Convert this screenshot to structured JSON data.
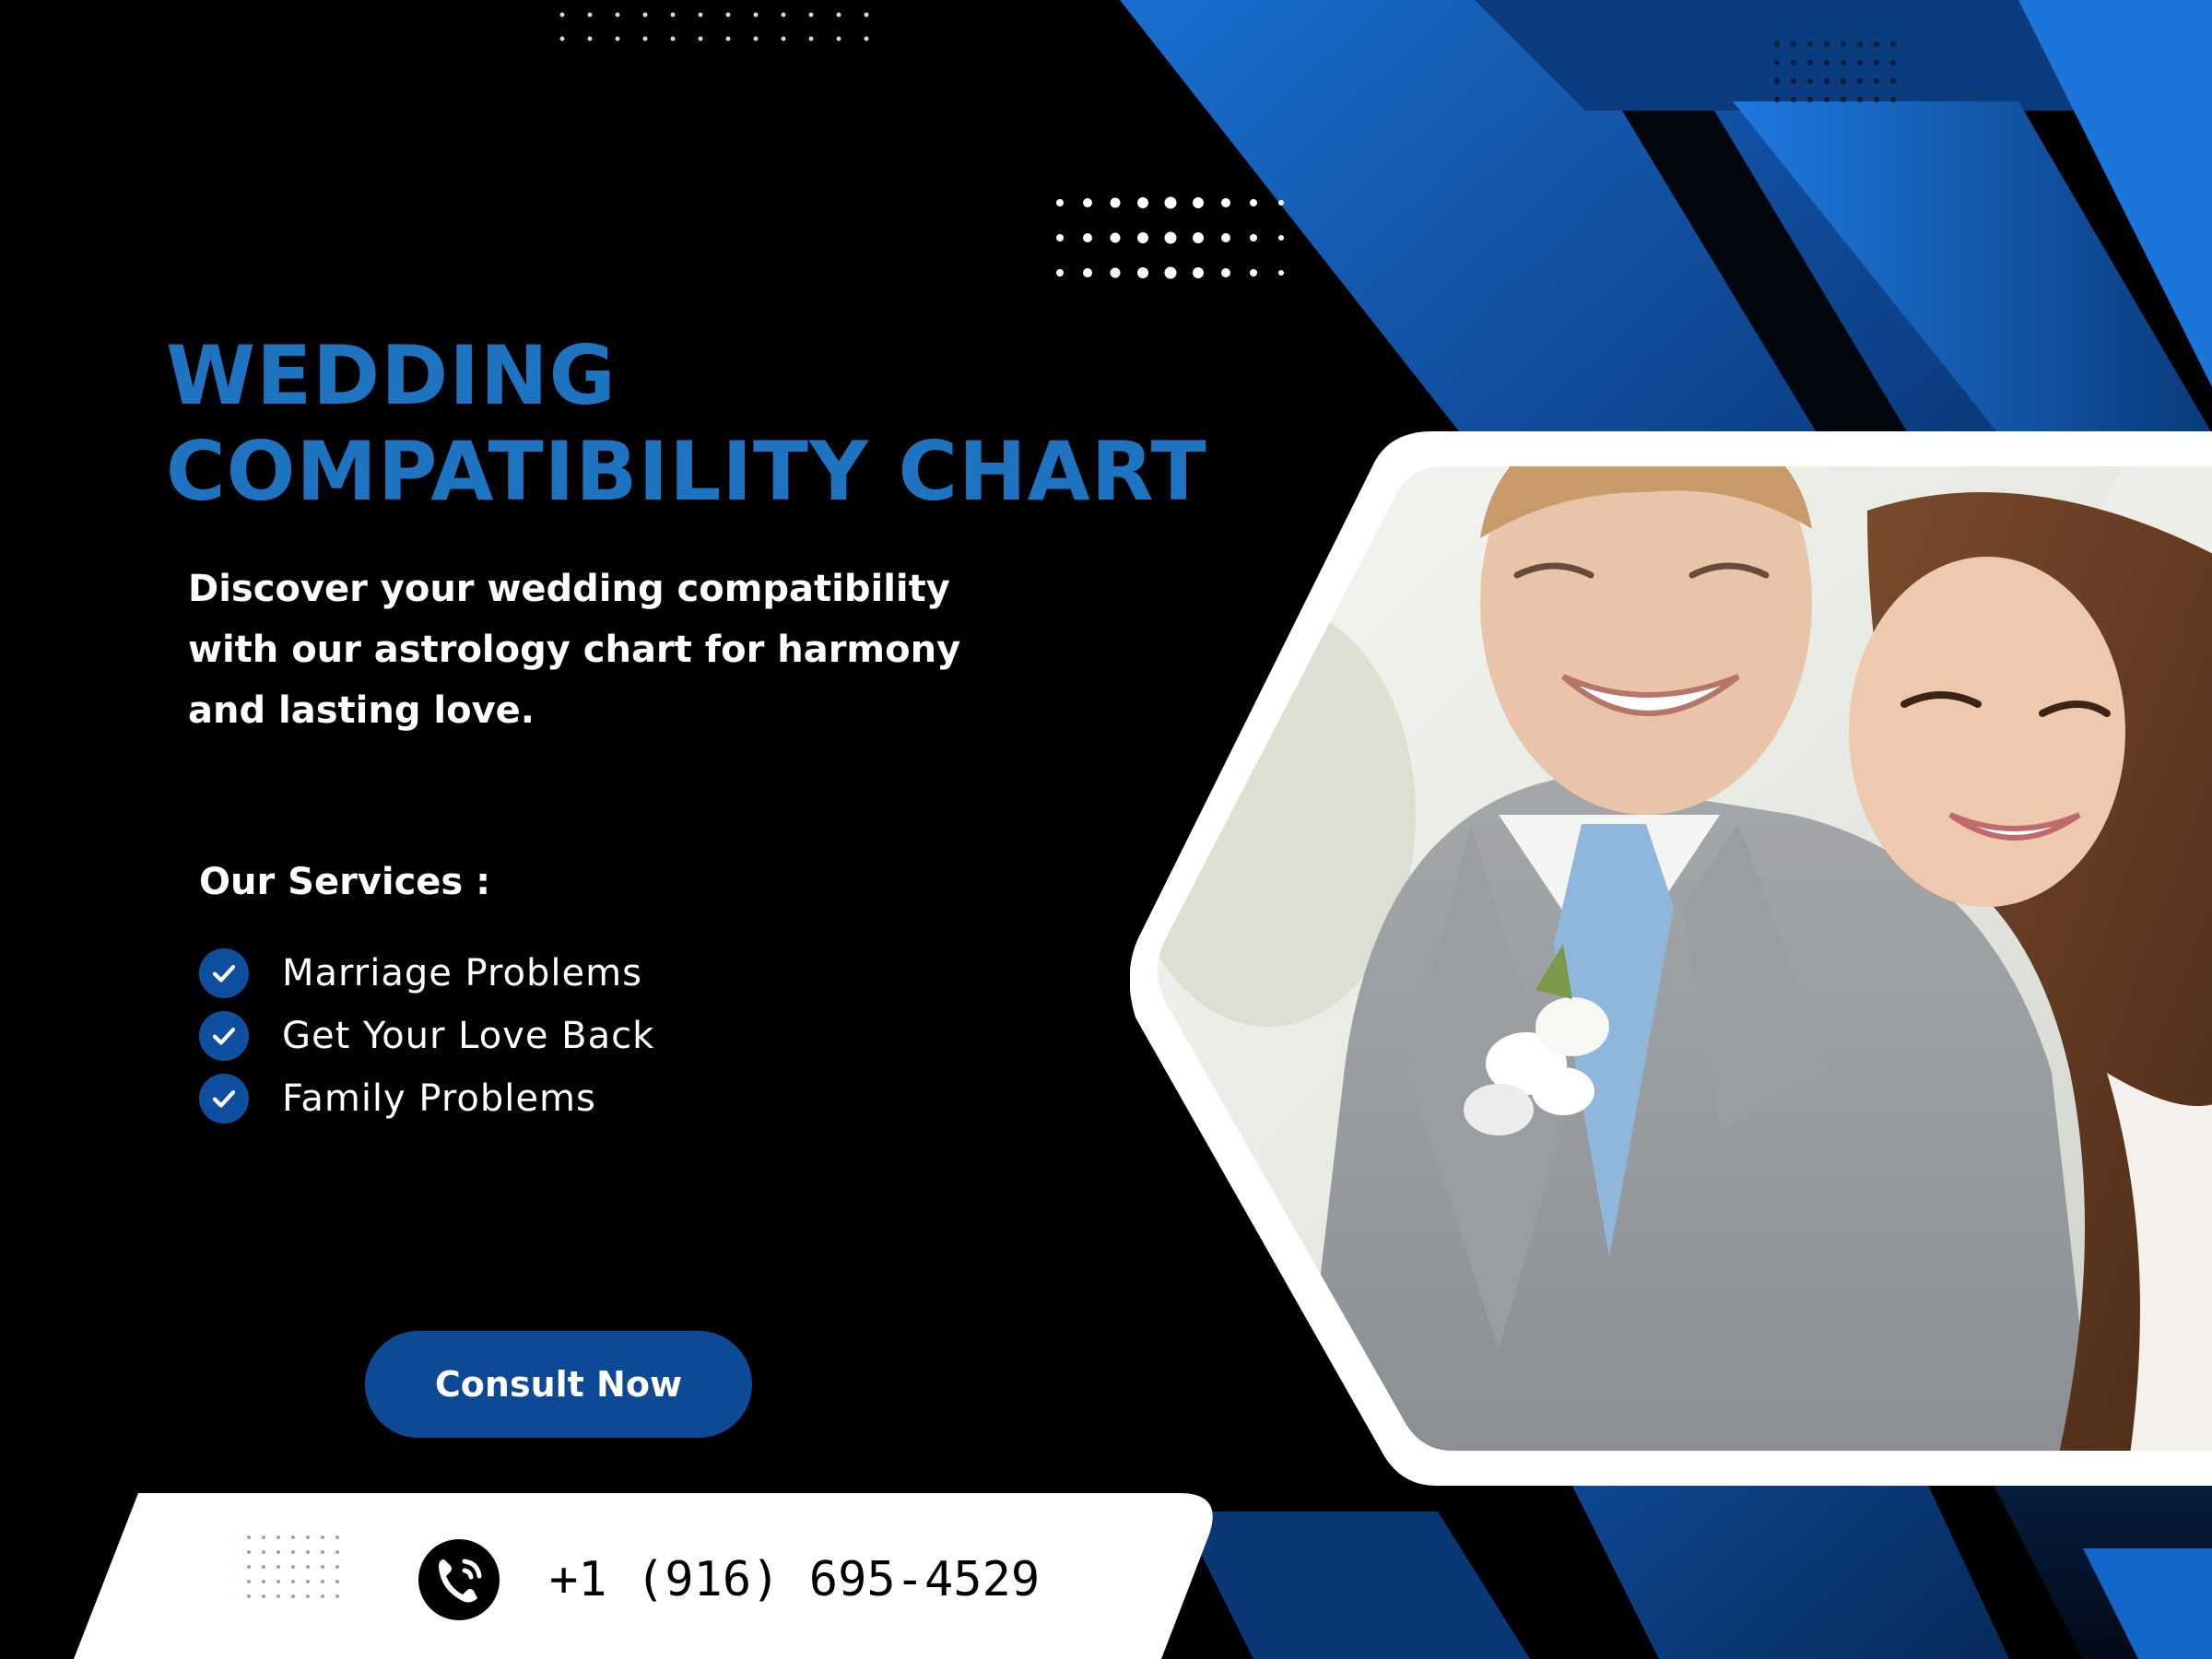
{
  "title": {
    "line1": "WEDDING",
    "line2": "COMPATIBILITY CHART"
  },
  "description": "Discover your wedding compatibility with our astrology chart for harmony and lasting love.",
  "services": {
    "heading": "Our Services :",
    "items": [
      {
        "label": "Marriage Problems",
        "icon": "check-icon"
      },
      {
        "label": "Get Your Love Back",
        "icon": "check-icon"
      },
      {
        "label": "Family Problems",
        "icon": "check-icon"
      }
    ]
  },
  "cta": {
    "label": "Consult Now"
  },
  "contact": {
    "phone": "+1 (916) 695-4529",
    "icon": "phone-icon"
  },
  "colors": {
    "background": "#000000",
    "title": "#1f74c2",
    "accent_blue": "#1565c0",
    "button": "#0e4996",
    "check_badge": "#0e4f9f",
    "text_light": "#ffffff",
    "footer_bar": "#ffffff"
  }
}
